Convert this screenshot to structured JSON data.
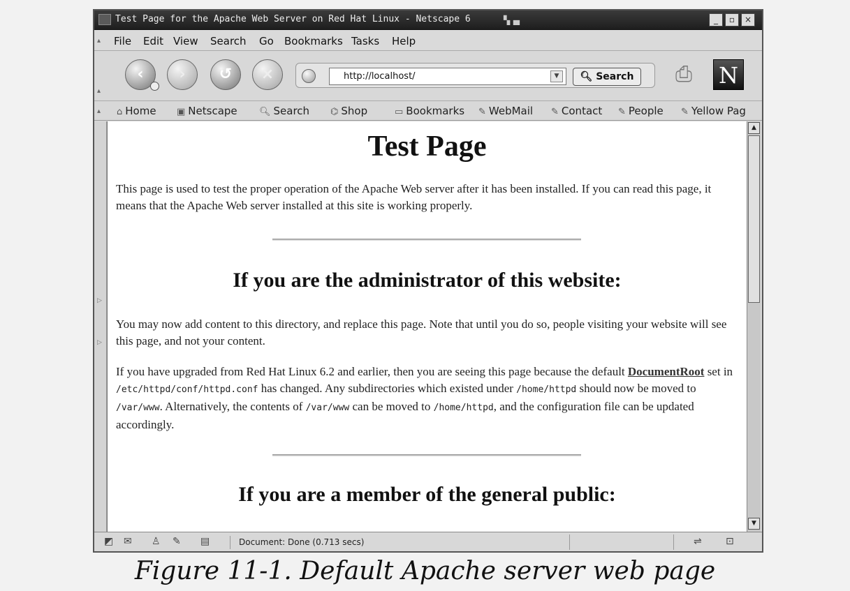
{
  "window": {
    "title": "Test Page for the Apache Web Server on Red Hat Linux - Netscape 6",
    "minimize": "_",
    "maximize": "▫",
    "close": "×"
  },
  "menubar": {
    "items": [
      "File",
      "Edit",
      "View",
      "Search",
      "Go",
      "Bookmarks",
      "Tasks",
      "Help"
    ]
  },
  "navbar": {
    "back_icon": "back-arrow-icon",
    "forward_icon": "forward-arrow-icon",
    "reload_icon": "reload-icon",
    "stop_icon": "stop-icon",
    "url": "http://localhost/",
    "search_label": "Search",
    "logo_letter": "N"
  },
  "personal_toolbar": {
    "items": [
      {
        "label": "Home",
        "icon": "home-icon"
      },
      {
        "label": "Netscape",
        "icon": "my-netscape-icon"
      },
      {
        "label": "Search",
        "icon": "search-icon"
      },
      {
        "label": "Shop",
        "icon": "shop-icon"
      },
      {
        "label": "Bookmarks",
        "icon": "folder-icon"
      },
      {
        "label": "WebMail",
        "icon": "bookmark-icon"
      },
      {
        "label": "Contact",
        "icon": "bookmark-icon"
      },
      {
        "label": "People",
        "icon": "bookmark-icon"
      },
      {
        "label": "Yellow Pag",
        "icon": "bookmark-icon"
      }
    ]
  },
  "page": {
    "title": "Test Page",
    "intro": "This page is used to test the proper operation of the Apache Web server after it has been installed. If you can read this page, it means that the Apache Web server installed at this site is working properly.",
    "admin_heading": "If you are the administrator of this website:",
    "admin_p1": "You may now add content to this directory, and replace this page. Note that until you do so, people visiting your website will see this page, and not your content.",
    "admin_p2": {
      "t1": "If you have upgraded from Red Hat Linux 6.2 and earlier, then you are seeing this page because the default ",
      "link": "DocumentRoot",
      "t2": " set in ",
      "c1": "/etc/httpd/conf/httpd.conf",
      "t3": " has changed. Any subdirectories which existed under ",
      "c2": "/home/httpd",
      "t4": " should now be moved to ",
      "c3": "/var/www",
      "t5": ". Alternatively, the contents of ",
      "c4": "/var/www",
      "t6": " can be moved to ",
      "c5": "/home/httpd",
      "t7": ", and the configuration file can be updated accordingly."
    },
    "public_heading": "If you are a member of the general public:"
  },
  "status": {
    "text": "Document: Done (0.713 secs)"
  },
  "caption": "Figure 11-1. Default Apache server web page"
}
